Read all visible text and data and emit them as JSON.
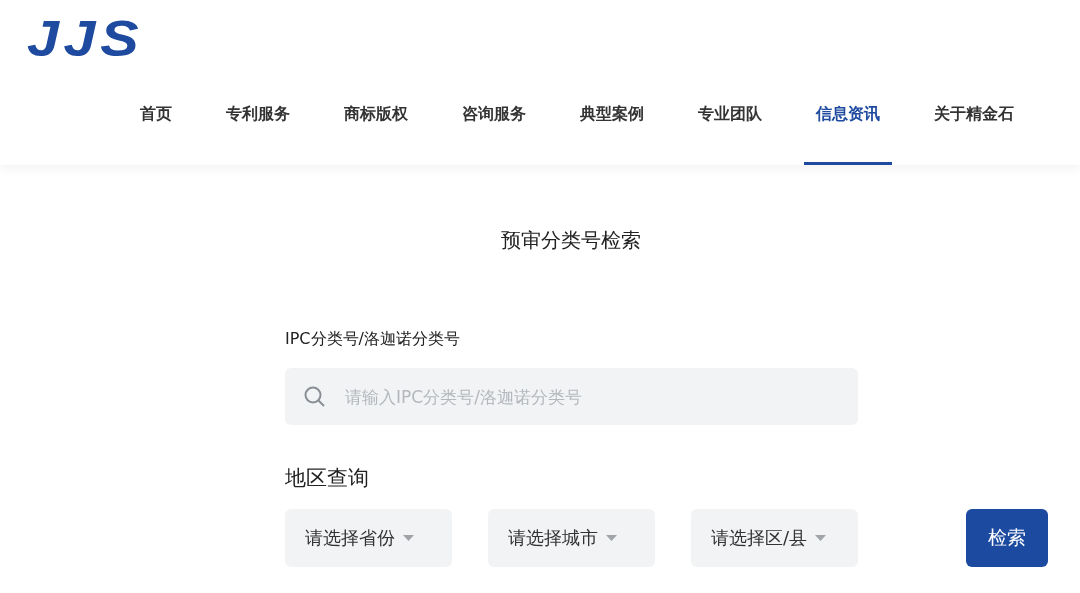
{
  "logo": {
    "text": "JJS"
  },
  "nav": [
    {
      "label": "首页",
      "selected": false
    },
    {
      "label": "专利服务",
      "selected": false
    },
    {
      "label": "商标版权",
      "selected": false
    },
    {
      "label": "咨询服务",
      "selected": false
    },
    {
      "label": "典型案例",
      "selected": false
    },
    {
      "label": "专业团队",
      "selected": false
    },
    {
      "label": "信息资讯",
      "selected": true
    },
    {
      "label": "关于精金石",
      "selected": false
    }
  ],
  "page_title": "预审分类号检索",
  "search": {
    "label": "IPC分类号/洛迦诺分类号",
    "placeholder": "请输入IPC分类号/洛迦诺分类号"
  },
  "region": {
    "label": "地区查询",
    "selects": [
      {
        "placeholder": "请选择省份"
      },
      {
        "placeholder": "请选择城市"
      },
      {
        "placeholder": "请选择区/县"
      }
    ]
  },
  "submit_button": "检索"
}
